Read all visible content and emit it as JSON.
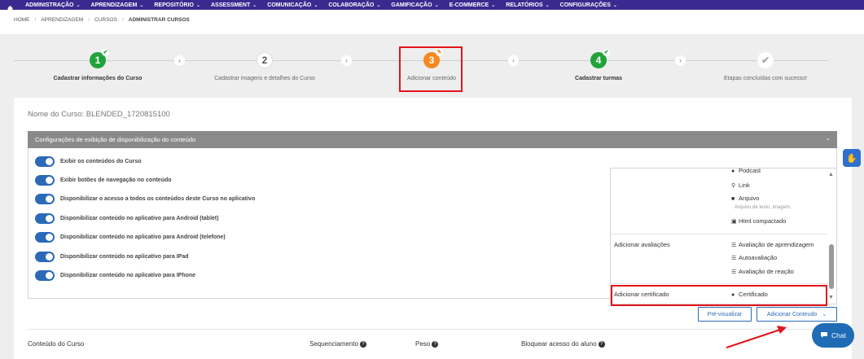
{
  "nav": {
    "items": [
      {
        "label": "ADMINISTRAÇÃO"
      },
      {
        "label": "APRENDIZAGEM"
      },
      {
        "label": "REPOSITÓRIO"
      },
      {
        "label": "ASSESSMENT"
      },
      {
        "label": "COMUNICAÇÃO"
      },
      {
        "label": "COLABORAÇÃO"
      },
      {
        "label": "GAMIFICAÇÃO"
      },
      {
        "label": "E-COMMERCE"
      },
      {
        "label": "RELATÓRIOS"
      },
      {
        "label": "CONFIGURAÇÕES"
      }
    ],
    "chevron": "⌄"
  },
  "breadcrumb": {
    "home": "HOME",
    "sep": "/",
    "level1": "APRENDIZAGEM",
    "level2": "CURSOS",
    "current": "ADMINISTRAR CURSOS"
  },
  "stepper": {
    "steps": [
      {
        "number": "1",
        "label": "Cadastrar informações do Curso",
        "state": "done"
      },
      {
        "number": "2",
        "label": "Cadastrar imagens e detalhes do Curso",
        "state": "pending"
      },
      {
        "number": "3",
        "label": "Adicionar conteúdo",
        "state": "current"
      },
      {
        "number": "4",
        "label": "Cadastrar turmas",
        "state": "done"
      },
      {
        "number": "✔",
        "label": "Etapas concluídas com sucesso!",
        "state": "final"
      }
    ],
    "arrow": "›"
  },
  "course_name": "Nome do Curso: BLENDED_1720815100",
  "panel": {
    "title": "Configurações de exibição de disponibilização do conteúdo",
    "chevron": "⌄",
    "toggles": [
      {
        "label": "Exibir os conteúdos do Curso",
        "on": true
      },
      {
        "label": "Exibir botões de navegação no conteúdo",
        "on": true
      },
      {
        "label": "Disponibilizar o acesso a todos os conteúdos deste Curso no aplicativo",
        "on": true
      },
      {
        "label": "Disponibilizar conteúdo no aplicativo para Android (tablet)",
        "on": true
      },
      {
        "label": "Disponibilizar conteúdo no aplicativo para Android (telefone)",
        "on": true
      },
      {
        "label": "Disponibilizar conteúdo no aplicativo para IPad",
        "on": true
      },
      {
        "label": "Disponibilizar conteúdo no aplicativo para IPhone",
        "on": true
      }
    ]
  },
  "dropdown": {
    "podcast": "Podcast",
    "link": "Link",
    "arquivo": "Arquivo",
    "arquivo_sub": "Arquivo de texto, imagem.",
    "html": "Html compactado",
    "group_avaliacoes": "Adicionar avaliações",
    "aval1": "Avaliação de aprendizagem",
    "aval2": "Autoavaliação",
    "aval3": "Avaliação de reação",
    "group_certificado": "Adicionar certificado",
    "certificado": "Certificado"
  },
  "buttons": {
    "preview": "Pré-visualizar",
    "add_content": "Adicionar Conteudo"
  },
  "table": {
    "col1": "Conteúdo do Curso",
    "col2": "Sequenciamento",
    "col3": "Peso",
    "col4": "Bloquear acesso do aluno",
    "help": "?"
  },
  "chat": {
    "label": "Chat"
  },
  "colors": {
    "nav_bg": "#3a2a8f",
    "primary": "#2a6ab8",
    "done_green": "#22a33a",
    "current_orange": "#f5891f",
    "highlight_red": "#e3141b"
  }
}
